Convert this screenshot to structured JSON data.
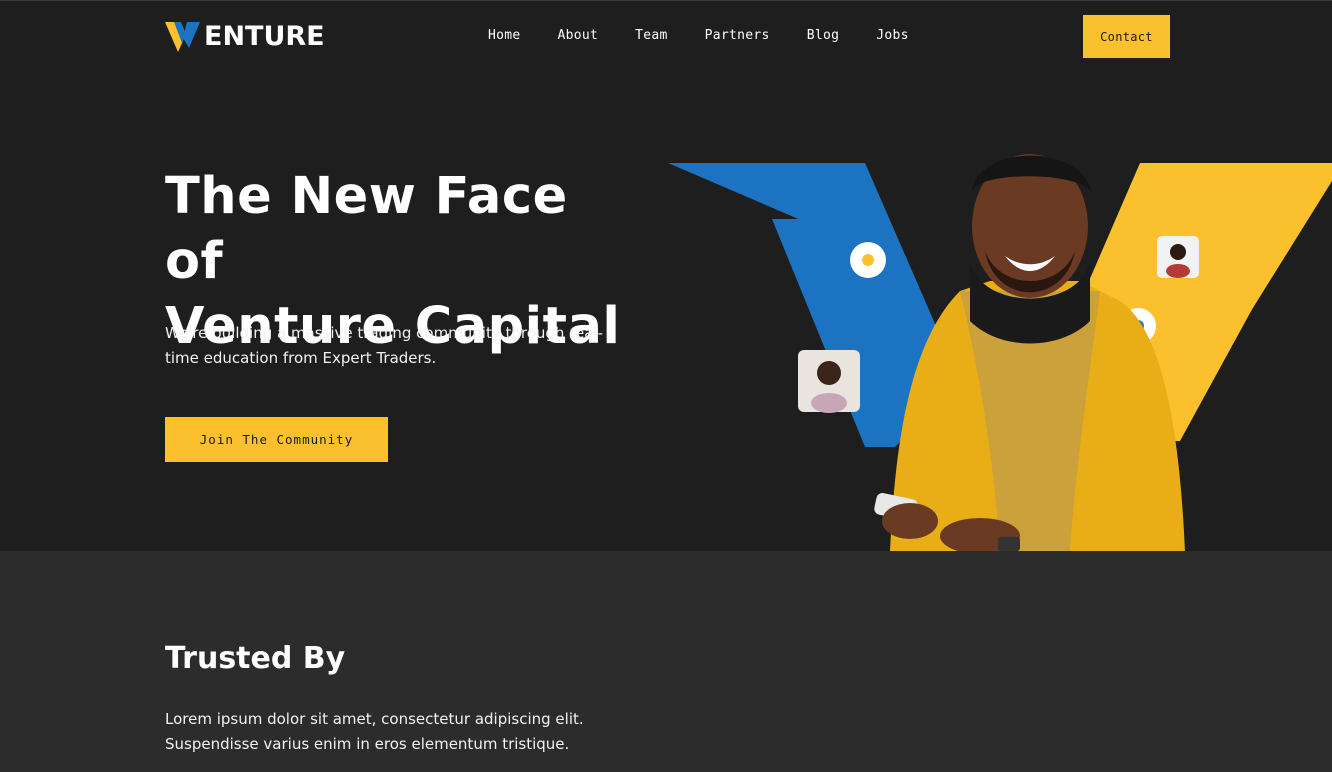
{
  "brand": {
    "logo_text": "ENTURE"
  },
  "nav": {
    "links": [
      "Home",
      "About",
      "Team",
      "Partners",
      "Blog",
      "Jobs"
    ],
    "contact_label": "Contact"
  },
  "hero": {
    "title_line1": "The New Face of",
    "title_line2": "Venture Capital",
    "subtitle": "We're building a massive trading community through real-time education from Expert Traders.",
    "cta_label": "Join The Community"
  },
  "trusted": {
    "title": "Trusted By",
    "description": "Lorem ipsum dolor sit amet, consectetur adipiscing elit. Suspendisse varius enim in eros elementum tristique."
  },
  "colors": {
    "accent_yellow": "#fbc02d",
    "accent_blue": "#1c73c1",
    "hero_bg": "#1e1e1e",
    "section_bg": "#2c2c2c"
  }
}
